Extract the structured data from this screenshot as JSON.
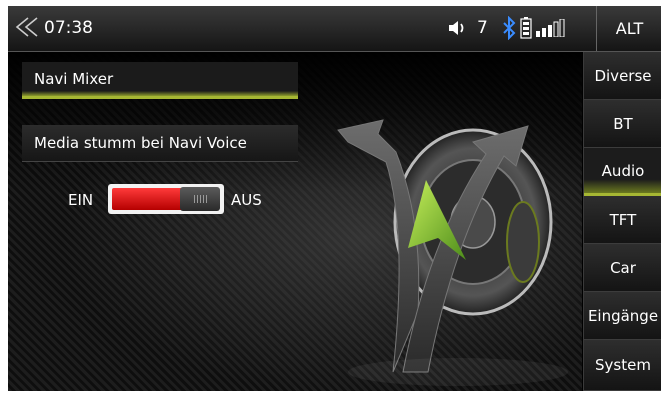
{
  "status": {
    "time": "07:38",
    "volume": "7",
    "alt_label": "ALT"
  },
  "settings": {
    "items": [
      {
        "label": "Navi Mixer",
        "selected": true
      },
      {
        "label": "Media stumm bei Navi Voice",
        "selected": false
      }
    ],
    "toggle": {
      "on_label": "EIN",
      "off_label": "AUS",
      "state": "EIN"
    }
  },
  "sidebar": {
    "items": [
      {
        "label": "Diverse"
      },
      {
        "label": "BT"
      },
      {
        "label": "Audio",
        "active": true
      },
      {
        "label": "TFT"
      },
      {
        "label": "Car"
      },
      {
        "label": "Eingänge"
      },
      {
        "label": "System"
      }
    ]
  },
  "colors": {
    "accent": "#a6b733",
    "toggle_on": "#e01010",
    "nav_arrow": "#8fc43a"
  },
  "icons": [
    "back-icon",
    "volume-icon",
    "bluetooth-icon",
    "battery-icon",
    "signal-icon"
  ]
}
